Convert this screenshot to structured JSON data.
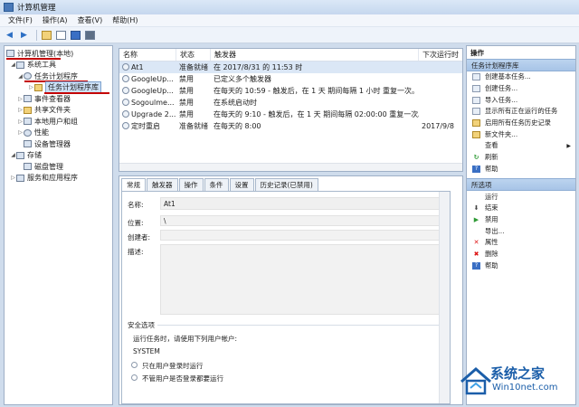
{
  "window": {
    "title": "计算机管理"
  },
  "menu": [
    "文件(F)",
    "操作(A)",
    "查看(V)",
    "帮助(H)"
  ],
  "tree": [
    {
      "label": "计算机管理(本地)",
      "level": 0,
      "twisty": ""
    },
    {
      "label": "系统工具",
      "level": 1,
      "twisty": "◢"
    },
    {
      "label": "任务计划程序",
      "level": 2,
      "twisty": "◢"
    },
    {
      "label": "任务计划程序库",
      "level": 3,
      "twisty": "▷",
      "selected": true
    },
    {
      "label": "事件查看器",
      "level": 2,
      "twisty": "▷"
    },
    {
      "label": "共享文件夹",
      "level": 2,
      "twisty": "▷"
    },
    {
      "label": "本地用户和组",
      "level": 2,
      "twisty": "▷"
    },
    {
      "label": "性能",
      "level": 2,
      "twisty": "▷"
    },
    {
      "label": "设备管理器",
      "level": 2,
      "twisty": ""
    },
    {
      "label": "存储",
      "level": 1,
      "twisty": "◢"
    },
    {
      "label": "磁盘管理",
      "level": 2,
      "twisty": ""
    },
    {
      "label": "服务和应用程序",
      "level": 1,
      "twisty": "▷"
    }
  ],
  "task_list": {
    "columns": [
      "名称",
      "状态",
      "触发器",
      "下次运行时"
    ],
    "rows": [
      {
        "name": "At1",
        "status": "准备就绪",
        "trigger": "在 2017/8/31 的 11:53 时",
        "next": ""
      },
      {
        "name": "GoogleUp...",
        "status": "禁用",
        "trigger": "已定义多个触发器",
        "next": ""
      },
      {
        "name": "GoogleUp...",
        "status": "禁用",
        "trigger": "在每天的 10:59 - 触发后，在 1 天 期间每隔 1 小时 重复一次。",
        "next": ""
      },
      {
        "name": "Sogoulme...",
        "status": "禁用",
        "trigger": "在系统启动时",
        "next": ""
      },
      {
        "name": "Upgrade 2...",
        "status": "禁用",
        "trigger": "在每天的 9:10 - 触发后，在 1 天 期间每隔 02:00:00 重复一次。",
        "next": ""
      },
      {
        "name": "定时重启",
        "status": "准备就绪",
        "trigger": "在每天的 8:00",
        "next": "2017/9/8"
      }
    ]
  },
  "detail": {
    "tabs": [
      "常规",
      "触发器",
      "操作",
      "条件",
      "设置",
      "历史记录(已禁用)"
    ],
    "name_label": "名称:",
    "name_value": "At1",
    "location_label": "位置:",
    "location_value": "\\",
    "author_label": "创建者:",
    "description_label": "描述:",
    "security_group": "安全选项",
    "run_as_label": "运行任务时，请使用下列用户帐户:",
    "run_as_value": "SYSTEM",
    "radio1": "只在用户登录时运行",
    "radio2": "不管用户是否登录都要运行"
  },
  "actions": {
    "title": "操作",
    "section1": "任务计划程序库",
    "items1": [
      {
        "label": "创建基本任务...",
        "icon": "task-icon"
      },
      {
        "label": "创建任务...",
        "icon": "task-icon"
      },
      {
        "label": "导入任务...",
        "icon": "import-icon"
      },
      {
        "label": "显示所有正在运行的任务",
        "icon": "list-icon"
      },
      {
        "label": "启用所有任务历史记录",
        "icon": "history-icon"
      },
      {
        "label": "新文件夹...",
        "icon": "folder-icon"
      },
      {
        "label": "查看",
        "icon": "",
        "submenu": true
      },
      {
        "label": "刷新",
        "icon": "refresh-icon"
      },
      {
        "label": "帮助",
        "icon": "help-icon"
      }
    ],
    "section2": "所选项",
    "items2": [
      {
        "label": "运行",
        "icon": "run-icon"
      },
      {
        "label": "结束",
        "icon": "stop-icon"
      },
      {
        "label": "禁用",
        "icon": "disable-icon"
      },
      {
        "label": "导出...",
        "icon": ""
      },
      {
        "label": "属性",
        "icon": "properties-icon"
      },
      {
        "label": "删除",
        "icon": "delete-icon"
      },
      {
        "label": "帮助",
        "icon": "help-icon"
      }
    ]
  },
  "watermark": {
    "line1": "系统之家",
    "line2": "Win10net.com"
  }
}
